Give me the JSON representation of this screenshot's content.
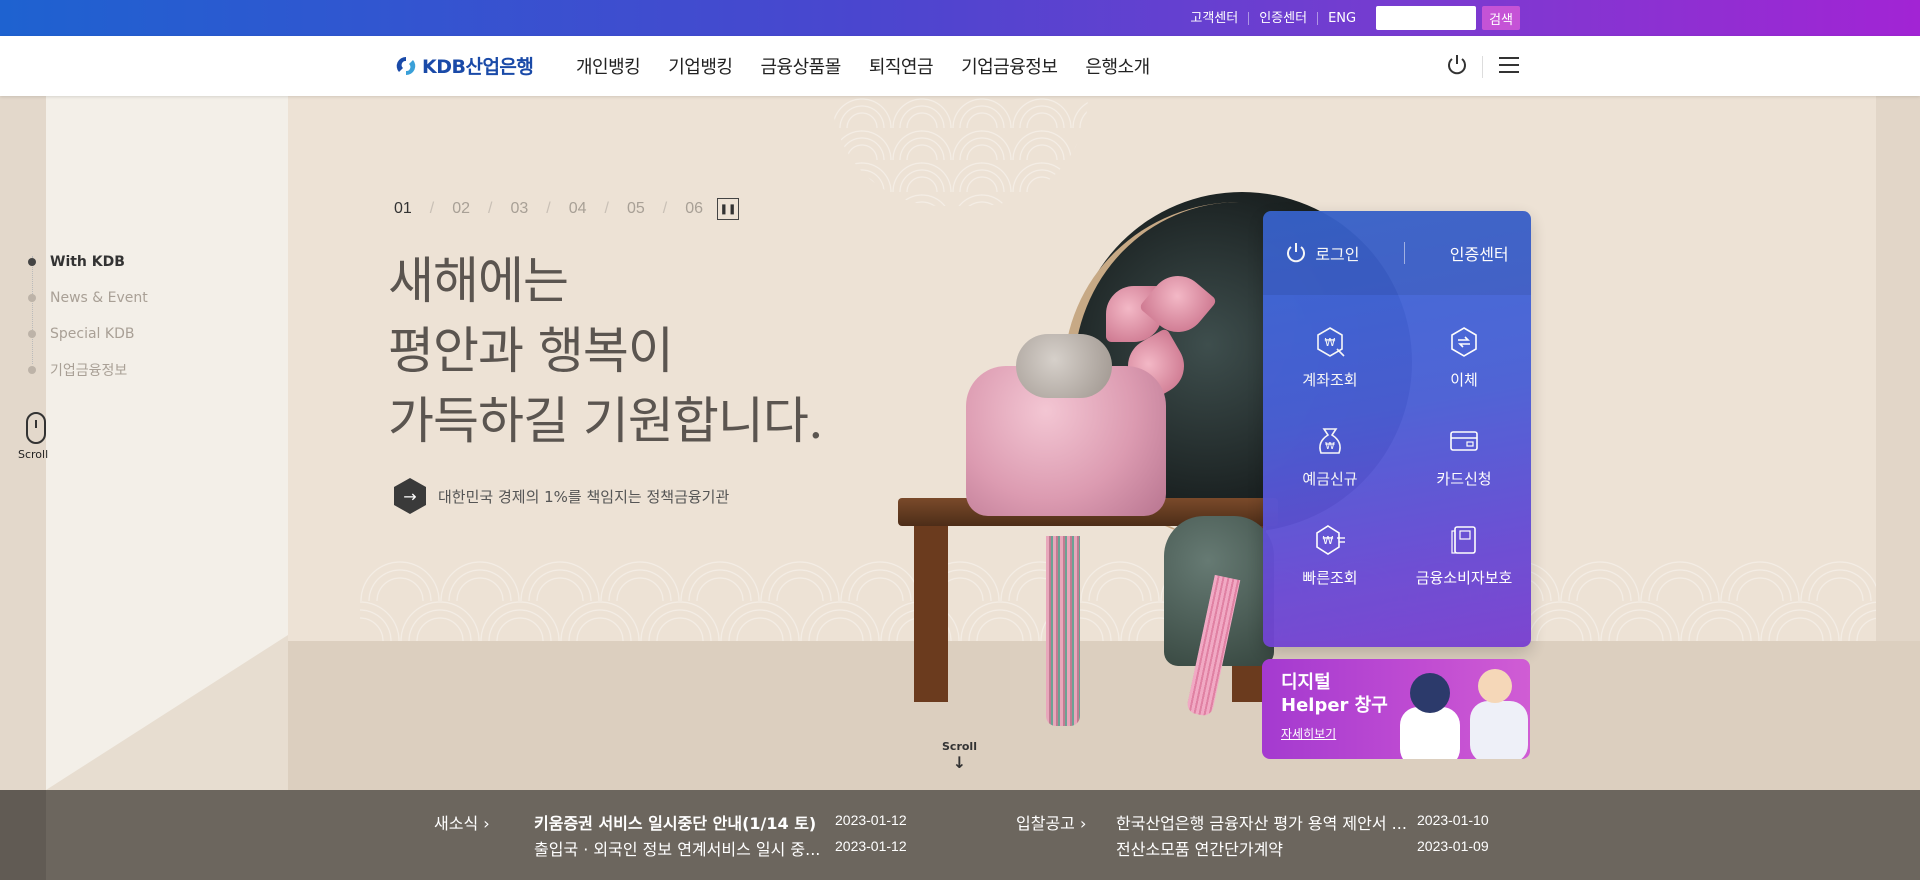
{
  "utility": {
    "links": [
      "고객센터",
      "인증센터",
      "ENG"
    ],
    "search_placeholder": "",
    "search_button": "검색"
  },
  "header": {
    "logo_text": "KDB산업은행",
    "nav": [
      "개인뱅킹",
      "기업뱅킹",
      "금융상품몰",
      "퇴직연금",
      "기업금융정보",
      "은행소개"
    ]
  },
  "side_nav": {
    "items": [
      "With KDB",
      "News & Event",
      "Special KDB",
      "기업금융정보"
    ],
    "active_index": 0,
    "scroll_label": "Scroll"
  },
  "hero": {
    "slides": [
      "01",
      "02",
      "03",
      "04",
      "05",
      "06"
    ],
    "current_slide": "01",
    "headline": [
      "새해에는",
      "평안과 행복이",
      "가득하길 기원합니다."
    ],
    "subline": "대한민국 경제의 1%를 책임지는 정책금융기관",
    "scroll_label": "Scroll"
  },
  "quick_menu": {
    "login": "로그인",
    "cert": "인증센터",
    "items": [
      {
        "label": "계좌조회",
        "icon": "account-inquiry-icon"
      },
      {
        "label": "이체",
        "icon": "transfer-icon"
      },
      {
        "label": "예금신규",
        "icon": "deposit-bag-icon"
      },
      {
        "label": "카드신청",
        "icon": "card-icon"
      },
      {
        "label": "빠른조회",
        "icon": "quick-inquiry-icon"
      },
      {
        "label": "금융소비자보호",
        "icon": "consumer-protection-icon"
      }
    ]
  },
  "helper_banner": {
    "line1": "디지털",
    "line2": "Helper 창구",
    "more": "자세히보기"
  },
  "notice": {
    "news_title": "새소식",
    "news": [
      {
        "text": "키움증권 서비스 일시중단 안내(1/14 토)",
        "date": "2023-01-12"
      },
      {
        "text": "출입국 · 외국인 정보 연계서비스 일시 중...",
        "date": "2023-01-12"
      }
    ],
    "bid_title": "입찰공고",
    "bids": [
      {
        "text": "한국산업은행 금융자산 평가 용역 제안서 ...",
        "date": "2023-01-10"
      },
      {
        "text": "전산소모품 연간단가계약",
        "date": "2023-01-09"
      }
    ]
  },
  "colors": {
    "topbar_start": "#1e62d0",
    "topbar_end": "#a224d4",
    "quick_menu": "#4a5fd6",
    "helper": "#c04cd2",
    "notice_bg": "#6c665e"
  }
}
